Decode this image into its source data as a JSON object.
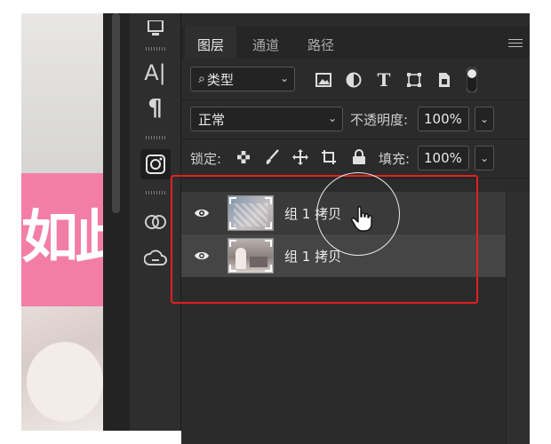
{
  "canvas": {
    "big_text": "如此"
  },
  "tabs": [
    {
      "label": "图层",
      "active": true
    },
    {
      "label": "通道",
      "active": false
    },
    {
      "label": "路径",
      "active": false
    }
  ],
  "filter": {
    "kind_label": "类型",
    "icons": [
      "image-filter-icon",
      "adjustment-filter-icon",
      "type-filter-icon",
      "shape-filter-icon",
      "smart-object-filter-icon",
      "filter-toggle-icon"
    ]
  },
  "blend": {
    "mode": "正常",
    "opacity_label": "不透明度:",
    "opacity_value": "100%"
  },
  "lock": {
    "label": "锁定:",
    "fill_label": "填充:",
    "fill_value": "100%"
  },
  "layers": [
    {
      "name": "组 1 拷贝",
      "visible": true,
      "selected": false
    },
    {
      "name": "组 1 拷贝",
      "visible": true,
      "selected": true
    }
  ],
  "tools": {
    "character_text": "A|",
    "paragraph_text": "¶"
  },
  "colors": {
    "panel_bg": "#2b2b2b",
    "highlight": "#e02020",
    "canvas_pink": "#f27ea6"
  }
}
